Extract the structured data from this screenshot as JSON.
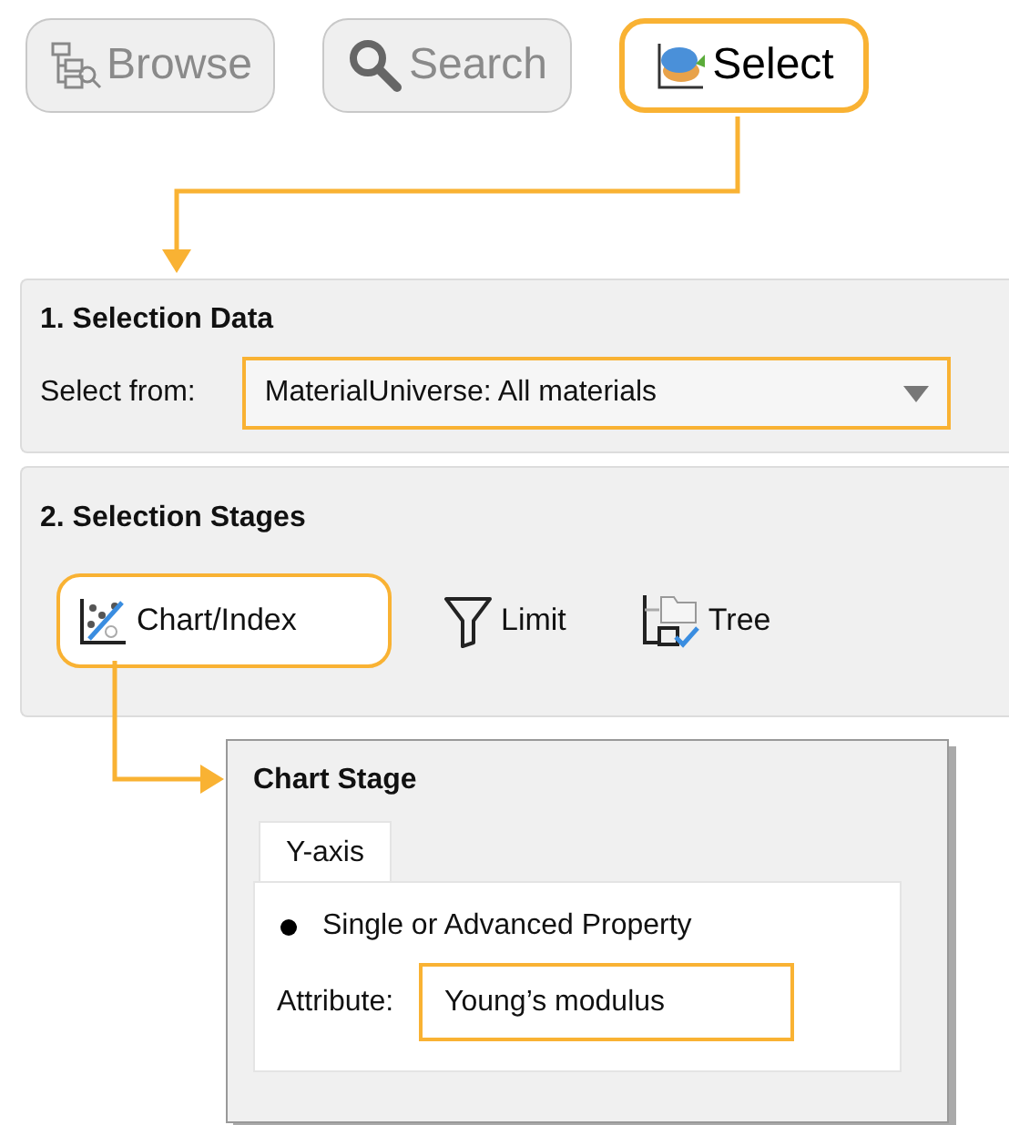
{
  "modes": [
    {
      "label": "Browse",
      "selected": false
    },
    {
      "label": "Search",
      "selected": false
    },
    {
      "label": "Select",
      "selected": true
    }
  ],
  "selection_data": {
    "title": "1. Selection Data",
    "label": "Select from:",
    "value": "MaterialUniverse: All materials",
    "highlighted": true
  },
  "selection_stages": {
    "title": "2. Selection Stages",
    "tools": [
      {
        "label": "Chart/Index",
        "selected": true
      },
      {
        "label": "Limit",
        "selected": false
      },
      {
        "label": "Tree",
        "selected": false
      }
    ]
  },
  "chart_stage": {
    "title": "Chart Stage",
    "tabs": [
      {
        "label": "Y-axis",
        "selected": true
      }
    ],
    "options": [
      {
        "label": "Single or Advanced Property",
        "selected": true
      }
    ],
    "attribute_label": "Attribute:",
    "attribute_value": "Young’s modulus",
    "highlighted": true
  }
}
